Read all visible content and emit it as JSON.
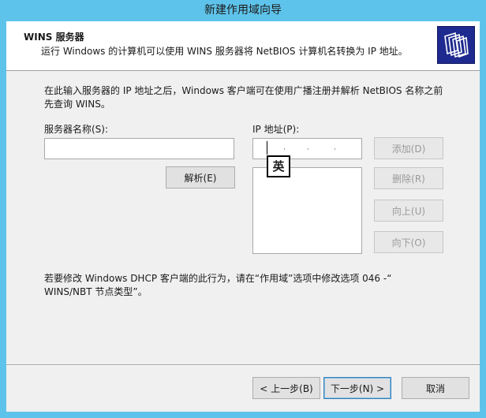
{
  "window": {
    "title": "新建作用域向导"
  },
  "header": {
    "title": "WINS 服务器",
    "subtitle": "运行 Windows 的计算机可以使用 WINS 服务器将 NetBIOS 计算机名转换为 IP 地址。",
    "icon": "folder-stack-icon"
  },
  "description": {
    "line1": "在此输入服务器的 IP 地址之后，Windows 客户端可在使用广播注册并解析 NetBIOS 名称之前",
    "line2": "先查询 WINS。"
  },
  "server_name": {
    "label": "服务器名称(S):",
    "value": "",
    "resolve_button": "解析(E)"
  },
  "ip_address": {
    "label": "IP 地址(P):",
    "value": "",
    "ime_indicator": "英"
  },
  "list_buttons": {
    "add": "添加(D)",
    "remove": "删除(R)",
    "up": "向上(U)",
    "down": "向下(O)"
  },
  "note": {
    "line1": "若要修改 Windows DHCP 客户端的此行为，请在“作用域”选项中修改选项 046 -“",
    "line2": "WINS/NBT 节点类型”。"
  },
  "footer": {
    "back": "< 上一步(B)",
    "next": "下一步(N) >",
    "cancel": "取消"
  },
  "colors": {
    "titlebar": "#5ec3ea",
    "dialog_bg": "#f0f0f0",
    "header_icon_bg": "#1e2a8f"
  }
}
